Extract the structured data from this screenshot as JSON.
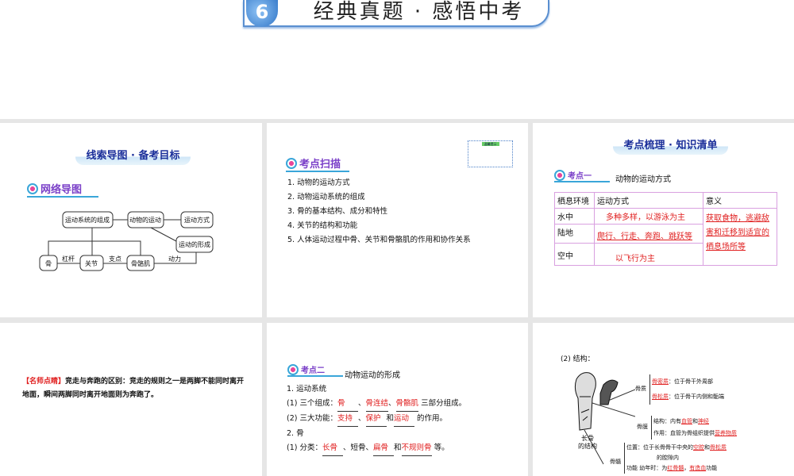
{
  "banner": {
    "number": "6",
    "title": "经典真题 · 感悟中考"
  },
  "p1": {
    "title": "线索导图 · 备考目标",
    "section": "网络导图",
    "nodes": {
      "composition": "运动系统的组成",
      "animal_motion": "动物的运动",
      "motion_mode": "运动方式",
      "formation": "运动的形成",
      "bone": "骨",
      "joint": "关节",
      "muscle": "骨骼肌"
    },
    "edges": {
      "lever": "杠杆",
      "fulcrum": "支点",
      "power": "动力"
    }
  },
  "p2": {
    "section": "考点扫描",
    "note_title": "温馨提示",
    "items": [
      "1. 动物的运动方式",
      "2. 动物运动系统的组成",
      "3. 骨的基本结构、成分和特性",
      "4. 关节的结构和功能",
      "5. 人体运动过程中骨、关节和骨骼肌的作用和协作关系"
    ]
  },
  "p3": {
    "title": "考点梳理 · 知识清单",
    "section": "考点一",
    "topic": "动物的运动方式",
    "headers": [
      "栖息环境",
      "运动方式",
      "意义"
    ],
    "rows": [
      {
        "env": "水中",
        "mode": "多种多样，以游泳为主"
      },
      {
        "env": "陆地",
        "mode": "爬行、行走、奔跑、跳跃等"
      },
      {
        "env": "空中",
        "mode": "以飞行为主"
      }
    ],
    "meaning": "获取食物，逃避敌害和迁移到适宜的栖息场所等"
  },
  "p4": {
    "tag": "【名师点睛】",
    "text": "竞走与奔跑的区别：竞走的规则之一是两脚不能同时离开地面，瞬间两脚同时离开地面则为奔跑了。"
  },
  "p5": {
    "section": "考点二",
    "topic": "动物运动的形成",
    "l1": "1. 运动系统",
    "l2a": "(1) 三个组成：",
    "a1": "骨",
    "a2": "骨连结",
    "a3": "骨骼肌",
    "l2b": "三部分组成。",
    "l3a": "(2) 三大功能：",
    "b1": "支持",
    "b2": "保护",
    "b3": "运动",
    "l3b": "的作用。",
    "l4": "2. 骨",
    "l5a": "(1) 分类：",
    "c1": "长骨",
    "c2": "短骨、",
    "c3": "扁骨",
    "c4": "不规则骨",
    "l5b": "等。",
    "and": "和",
    "sep": "、"
  },
  "p6": {
    "heading": "(2) 结构：",
    "caption": "长骨\n的结构",
    "bone_matter": "骨质",
    "compact": "骨密质",
    "compact_desc": "：位于骨干外周部",
    "spongy": "骨松质",
    "spongy_desc": "：位于骨干内侧和骺端",
    "periosteum": "骨膜",
    "peri_struct": "结构：内有",
    "vessel": "血管",
    "and": "和",
    "nerve": "神经",
    "peri_func": "作用：血管为骨组织提供",
    "nutrient": "营养物质",
    "marrow": "骨髓",
    "pos": "位置：位于长骨骨干中央的",
    "cavity": "空腔",
    "spongy2": "骨松质",
    "pos2": "的腔隙内",
    "func": "功能",
    "child": "幼年时：为",
    "red_marrow": "红骨髓",
    "hema": "有造血",
    "func_end": "功能"
  }
}
